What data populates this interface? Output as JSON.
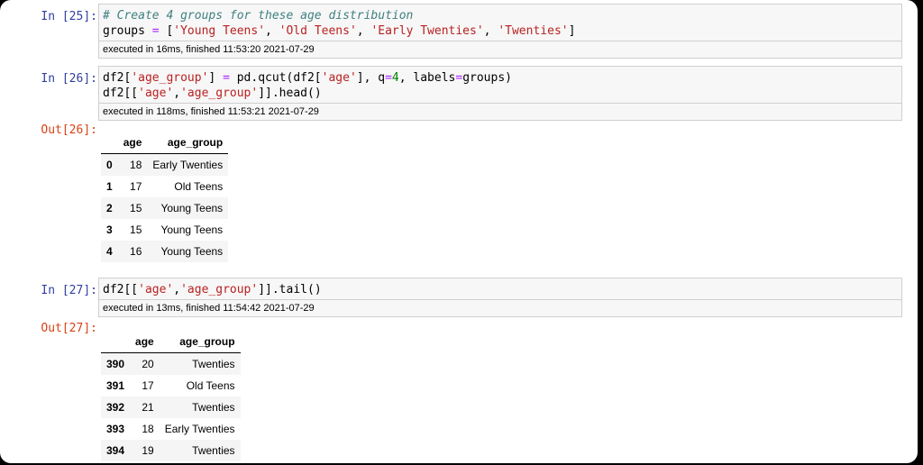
{
  "cells": [
    {
      "in_prompt": "In [25]:",
      "code_lines": [
        [
          {
            "t": "cm",
            "v": "# Create 4 groups for these age distribution"
          }
        ],
        [
          {
            "t": "",
            "v": "groups "
          },
          {
            "t": "op",
            "v": "="
          },
          {
            "t": "",
            "v": " ["
          },
          {
            "t": "s",
            "v": "'Young Teens'"
          },
          {
            "t": "",
            "v": ", "
          },
          {
            "t": "s",
            "v": "'Old Teens'"
          },
          {
            "t": "",
            "v": ", "
          },
          {
            "t": "s",
            "v": "'Early Twenties'"
          },
          {
            "t": "",
            "v": ", "
          },
          {
            "t": "s",
            "v": "'Twenties'"
          },
          {
            "t": "",
            "v": "]"
          }
        ]
      ],
      "exec": "executed in 16ms, finished 11:53:20 2021-07-29"
    },
    {
      "in_prompt": "In [26]:",
      "code_lines": [
        [
          {
            "t": "",
            "v": "df2["
          },
          {
            "t": "s",
            "v": "'age_group'"
          },
          {
            "t": "",
            "v": "] "
          },
          {
            "t": "op",
            "v": "="
          },
          {
            "t": "",
            "v": " pd.qcut(df2["
          },
          {
            "t": "s",
            "v": "'age'"
          },
          {
            "t": "",
            "v": "], q"
          },
          {
            "t": "op",
            "v": "="
          },
          {
            "t": "nm",
            "v": "4"
          },
          {
            "t": "",
            "v": ", labels"
          },
          {
            "t": "op",
            "v": "="
          },
          {
            "t": "",
            "v": "groups)"
          }
        ],
        [
          {
            "t": "",
            "v": "df2[["
          },
          {
            "t": "s",
            "v": "'age'"
          },
          {
            "t": "",
            "v": ","
          },
          {
            "t": "s",
            "v": "'age_group'"
          },
          {
            "t": "",
            "v": "]].head()"
          }
        ]
      ],
      "exec": "executed in 118ms, finished 11:53:21 2021-07-29",
      "out_prompt": "Out[26]:",
      "table": {
        "columns": [
          "age",
          "age_group"
        ],
        "rows": [
          {
            "index": "0",
            "age": "18",
            "age_group": "Early Twenties"
          },
          {
            "index": "1",
            "age": "17",
            "age_group": "Old Teens"
          },
          {
            "index": "2",
            "age": "15",
            "age_group": "Young Teens"
          },
          {
            "index": "3",
            "age": "15",
            "age_group": "Young Teens"
          },
          {
            "index": "4",
            "age": "16",
            "age_group": "Young Teens"
          }
        ]
      }
    },
    {
      "in_prompt": "In [27]:",
      "code_lines": [
        [
          {
            "t": "",
            "v": "df2[["
          },
          {
            "t": "s",
            "v": "'age'"
          },
          {
            "t": "",
            "v": ","
          },
          {
            "t": "s",
            "v": "'age_group'"
          },
          {
            "t": "",
            "v": "]].tail()"
          }
        ]
      ],
      "exec": "executed in 13ms, finished 11:54:42 2021-07-29",
      "out_prompt": "Out[27]:",
      "table": {
        "columns": [
          "age",
          "age_group"
        ],
        "rows": [
          {
            "index": "390",
            "age": "20",
            "age_group": "Twenties"
          },
          {
            "index": "391",
            "age": "17",
            "age_group": "Old Teens"
          },
          {
            "index": "392",
            "age": "21",
            "age_group": "Twenties"
          },
          {
            "index": "393",
            "age": "18",
            "age_group": "Early Twenties"
          },
          {
            "index": "394",
            "age": "19",
            "age_group": "Twenties"
          }
        ]
      }
    }
  ]
}
